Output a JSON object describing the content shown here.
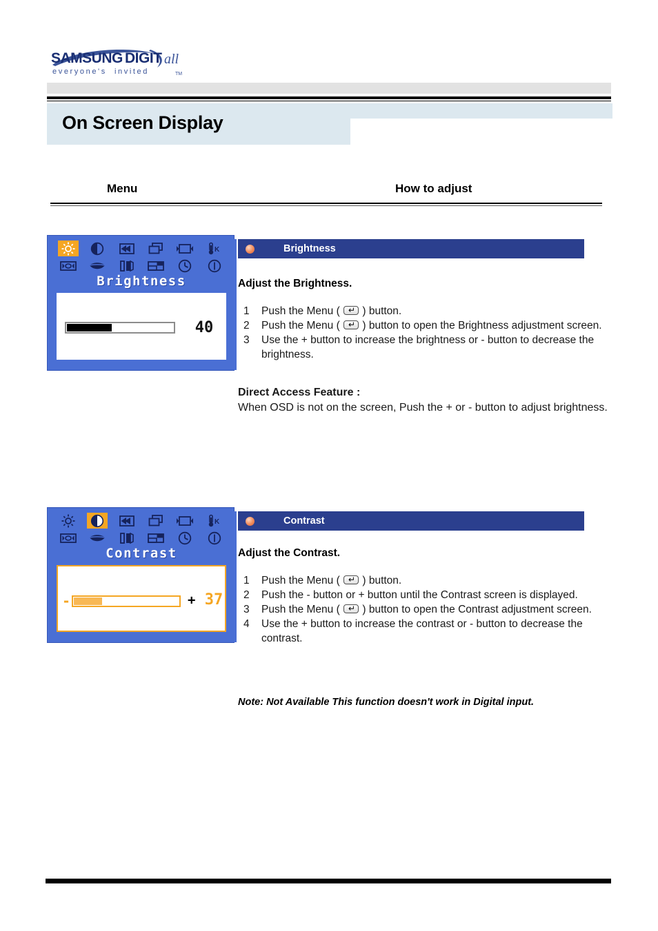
{
  "brand": {
    "logo_main": "SAMSUNG DIGITall",
    "logo_tagline": "everyone's invited",
    "logo_tm": "TM",
    "logo_color": "#3b5499"
  },
  "header": {
    "page_title": "On Screen Display",
    "title_bg": "#dce8ef"
  },
  "columns": {
    "left_header": "Menu",
    "right_header": "How to adjust"
  },
  "osd_icons": [
    {
      "name": "brightness-sun-icon",
      "selected_in": "brightness"
    },
    {
      "name": "contrast-halfcircle-icon",
      "selected_in": "contrast"
    },
    {
      "name": "h-position-arrows-icon",
      "selected_in": null
    },
    {
      "name": "image-size-layers-icon",
      "selected_in": null
    },
    {
      "name": "v-position-icon",
      "selected_in": null
    },
    {
      "name": "color-temperature-k-icon",
      "selected_in": null
    },
    {
      "name": "image-lock-icon",
      "selected_in": null
    },
    {
      "name": "color-control-lips-icon",
      "selected_in": null
    },
    {
      "name": "sharpness-bars-icon",
      "selected_in": null
    },
    {
      "name": "osd-position-icon",
      "selected_in": null
    },
    {
      "name": "osd-timer-clock-icon",
      "selected_in": null
    },
    {
      "name": "information-icon",
      "selected_in": null
    }
  ],
  "brightness": {
    "osd_title": "Brightness",
    "section_label": "Brightness",
    "value": 40,
    "slider_percent": 42,
    "slider_fill_color": "#000000",
    "panel_color": "#4a6fd4",
    "highlight_color": "#f5a623",
    "sub_head": "Adjust the Brightness.",
    "steps": [
      {
        "num": "1",
        "before": "Push the Menu (",
        "icon": "menu-enter-button-icon",
        "after": ") button."
      },
      {
        "num": "2",
        "before": "Push the Menu (",
        "icon": "menu-enter-button-icon",
        "after": ") button to open the Brightness adjustment screen."
      },
      {
        "num": "3",
        "before": "Use the + button to increase the brightness or - button to decrease the brightness.",
        "icon": null,
        "after": ""
      }
    ],
    "direct_access_head": "Direct Access Feature :",
    "direct_access_body": "When OSD is not on the screen, Push the + or - button to adjust brightness."
  },
  "contrast": {
    "osd_title": "Contrast",
    "section_label": "Contrast",
    "value": 37,
    "slider_percent": 27,
    "slider_fill_color": "#f8b855",
    "minus_label": "-",
    "plus_label": "+",
    "panel_color": "#4a6fd4",
    "highlight_color": "#f5a623",
    "sub_head": "Adjust the Contrast.",
    "steps": [
      {
        "num": "1",
        "before": "Push the Menu (",
        "icon": "menu-enter-button-icon",
        "after": ") button."
      },
      {
        "num": "2",
        "before": "Push the - button or + button until the Contrast screen is displayed.",
        "icon": null,
        "after": ""
      },
      {
        "num": "3",
        "before": "Push the Menu (",
        "icon": "menu-enter-button-icon",
        "after": ") button to open the Contrast adjustment screen."
      },
      {
        "num": "4",
        "before": "Use the + button to increase the contrast or - button to decrease the contrast.",
        "icon": null,
        "after": ""
      }
    ],
    "note": "Note: Not Available  This function doesn't work in Digital input."
  },
  "theme": {
    "section_bar_color": "#2b3f8e",
    "bullet_color": "#f08a5a",
    "accent_orange": "#f5a623",
    "osd_blue": "#4a6fd4"
  }
}
